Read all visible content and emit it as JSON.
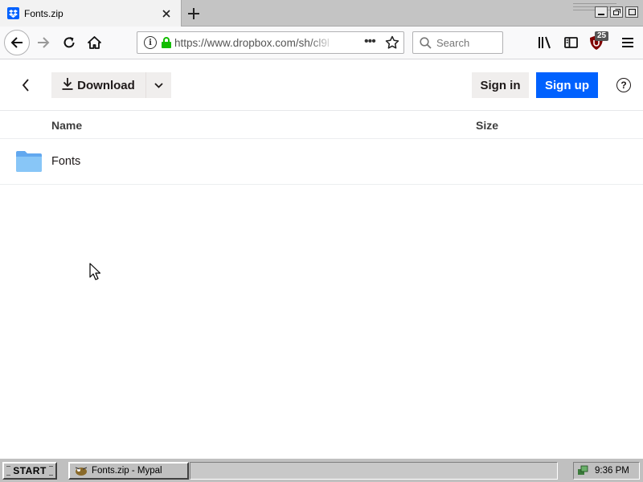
{
  "browser": {
    "tab": {
      "title": "Fonts.zip"
    },
    "url": "https://www.dropbox.com/sh/cl9l",
    "search_placeholder": "Search",
    "addon_badge": "25"
  },
  "page": {
    "download_label": "Download",
    "signin_label": "Sign in",
    "signup_label": "Sign up",
    "help_label": "?",
    "columns": {
      "name": "Name",
      "size": "Size"
    },
    "files": [
      {
        "name": "Fonts",
        "type": "folder-icon",
        "size": ""
      }
    ]
  },
  "colors": {
    "accent": "#0061fe",
    "folder": "#88c6f7"
  },
  "taskbar": {
    "start_label": "START",
    "task_label": "Fonts.zip - Mypal",
    "clock": "9:36 PM"
  }
}
